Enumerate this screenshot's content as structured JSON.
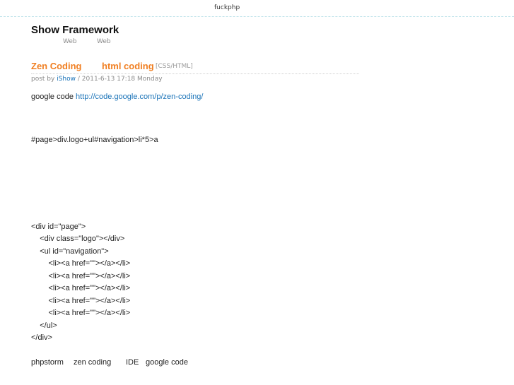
{
  "topbar": {
    "link": "fuckphp"
  },
  "site": {
    "title": "Show Framework",
    "nav": [
      "Web",
      "Web"
    ]
  },
  "post": {
    "title_part1": "Zen Coding",
    "title_part2": "html coding",
    "category": "[CSS/HTML]",
    "meta_prefix": "post by",
    "author": "iShow",
    "meta_suffix": "/ 2011-6-13 17:18 Monday",
    "intro_text": "google code",
    "intro_link": "http://code.google.com/p/zen-coding/",
    "abbreviation": "#page>div.logo+ul#navigation>li*5>a",
    "code_lines": [
      "<div id=\"page\">",
      "    <div class=\"logo\"></div>",
      "    <ul id=\"navigation\">",
      "        <li><a href=\"\"></a></li>",
      "        <li><a href=\"\"></a></li>",
      "        <li><a href=\"\"></a></li>",
      "        <li><a href=\"\"></a></li>",
      "        <li><a href=\"\"></a></li>",
      "    </ul>",
      "</div>"
    ],
    "tags": [
      "phpstorm",
      "zen coding",
      "IDE",
      "google code"
    ]
  }
}
